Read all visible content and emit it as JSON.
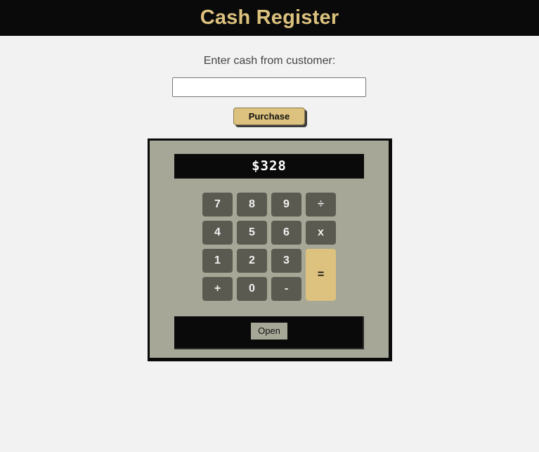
{
  "header": {
    "title": "Cash Register"
  },
  "form": {
    "prompt": "Enter cash from customer:",
    "input_value": "",
    "purchase_label": "Purchase"
  },
  "register": {
    "display_value": "$328",
    "keys": {
      "k7": "7",
      "k8": "8",
      "k9": "9",
      "divide": "÷",
      "k4": "4",
      "k5": "5",
      "k6": "6",
      "multiply": "x",
      "k1": "1",
      "k2": "2",
      "k3": "3",
      "equals": "=",
      "plus": "+",
      "k0": "0",
      "minus": "-"
    },
    "drawer_button_label": "Open"
  },
  "colors": {
    "header_bg": "#0a0a0a",
    "accent_gold": "#dcc27e",
    "register_body": "#a6a796",
    "key_bg": "#5a5a50",
    "page_bg": "#f2f2f2"
  }
}
